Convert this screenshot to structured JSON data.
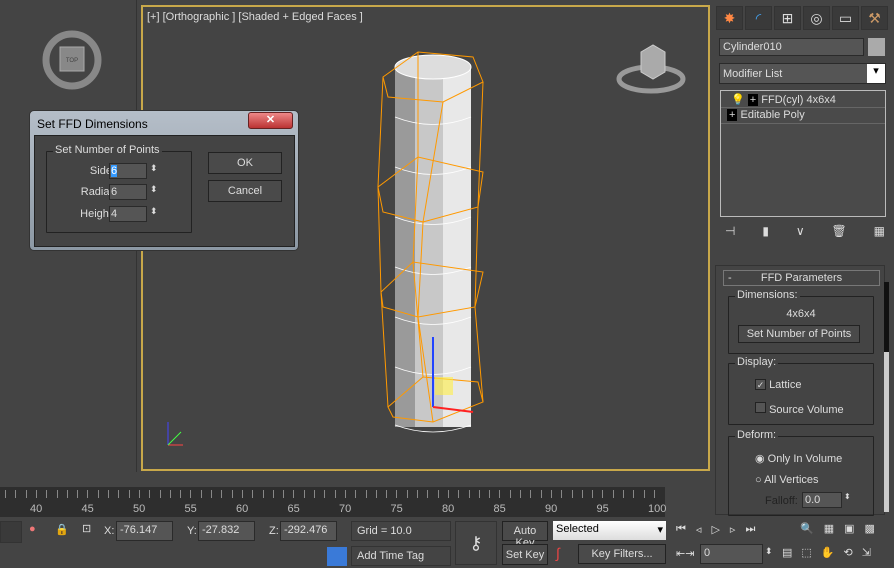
{
  "viewport": {
    "label": "[+] [Orthographic ] [Shaded + Edged Faces ]",
    "viewcube_left": "TOP"
  },
  "panel": {
    "tabs": [
      "create-icon",
      "modify-icon",
      "hierarchy-icon",
      "motion-icon",
      "display-icon",
      "utilities-icon"
    ],
    "object_name": "Cylinder010",
    "modifier_list": "Modifier List",
    "stack": [
      {
        "label": "FFD(cyl) 4x6x4"
      },
      {
        "label": "Editable Poly"
      }
    ],
    "rollout_title": "FFD Parameters",
    "dimensions_title": "Dimensions:",
    "dimensions_value": "4x6x4",
    "set_points_button": "Set Number of Points",
    "display_title": "Display:",
    "lattice": "Lattice",
    "lattice_checked": true,
    "source_volume": "Source Volume",
    "source_volume_checked": false,
    "deform_title": "Deform:",
    "only_in_volume": "Only In Volume",
    "all_vertices": "All Vertices",
    "falloff_label": "Falloff:",
    "falloff_value": "0.0"
  },
  "dialog": {
    "title": "Set FFD Dimensions",
    "group": "Set Number of Points",
    "side_label": "Side:",
    "side_value": "6",
    "radial_label": "Radial:",
    "radial_value": "6",
    "height_label": "Height:",
    "height_value": "4",
    "ok": "OK",
    "cancel": "Cancel",
    "close": "✕"
  },
  "timeline": {
    "ticks": [
      "40",
      "45",
      "50",
      "55",
      "60",
      "65",
      "70",
      "75",
      "80",
      "85",
      "90",
      "95",
      "100"
    ]
  },
  "status": {
    "x_label": "X:",
    "x": "-76.147",
    "y_label": "Y:",
    "y": "-27.832",
    "z_label": "Z:",
    "z": "-292.476",
    "grid": "Grid = 10.0",
    "add_time_tag": "Add Time Tag",
    "auto_key": "Auto Key",
    "set_key": "Set Key",
    "selected": "Selected",
    "key_filters": "Key Filters...",
    "frame": "0"
  }
}
